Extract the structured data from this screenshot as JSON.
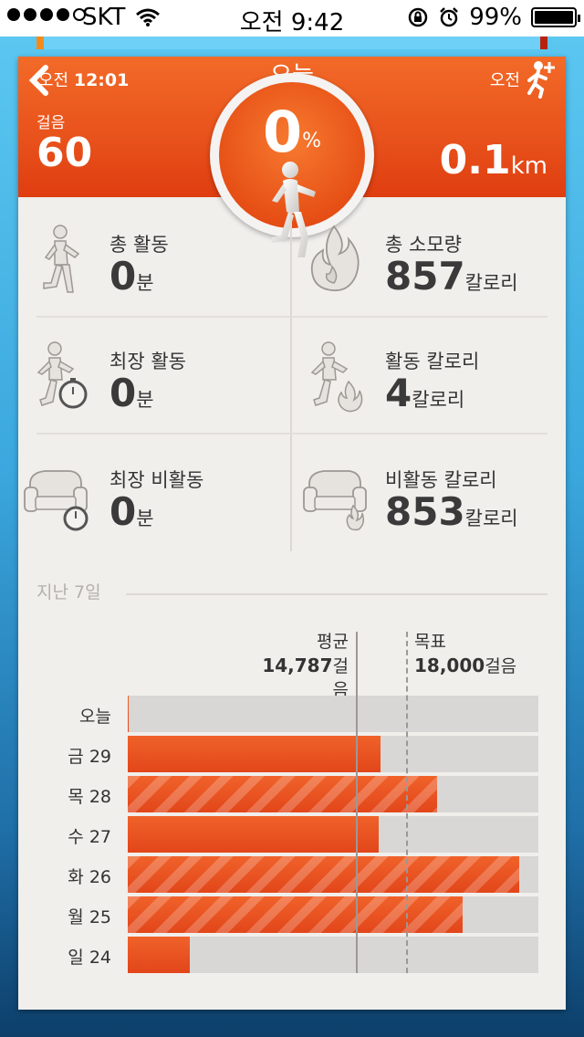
{
  "status_bar": {
    "carrier": "SKT",
    "time": "오전 9:42",
    "battery": "99%"
  },
  "header": {
    "back_time_prefix": "오전",
    "back_time": "12:01",
    "title": "오늘",
    "right_time_prefix": "오전",
    "steps_label": "걸음",
    "steps_value": "60",
    "percent_value": "0",
    "percent_unit": "%",
    "distance_value": "0.1",
    "distance_unit": "km",
    "colors": {
      "accent": "#e8511b",
      "accent_dark": "#d63f0e"
    }
  },
  "stats": [
    {
      "label": "총 활동",
      "value": "0",
      "unit": "분",
      "icon": "walking-person-icon"
    },
    {
      "label": "총 소모량",
      "value": "857",
      "unit": "칼로리",
      "icon": "flame-icon"
    },
    {
      "label": "최장 활동",
      "value": "0",
      "unit": "분",
      "icon": "person-stopwatch-icon"
    },
    {
      "label": "활동 칼로리",
      "value": "4",
      "unit": "칼로리",
      "icon": "person-flame-icon"
    },
    {
      "label": "최장 비활동",
      "value": "0",
      "unit": "분",
      "icon": "armchair-stopwatch-icon"
    },
    {
      "label": "비활동 칼로리",
      "value": "853",
      "unit": "칼로리",
      "icon": "armchair-flame-icon"
    }
  ],
  "week": {
    "title": "지난 7일",
    "avg_label": "평균",
    "avg_value": "14,787",
    "avg_unit": "걸음",
    "goal_label": "목표",
    "goal_value": "18,000",
    "goal_unit": "걸음",
    "days": [
      {
        "label": "오늘",
        "steps_fraction": 0.003,
        "striped": false
      },
      {
        "label": "금 29",
        "steps_fraction": 0.615,
        "striped": false
      },
      {
        "label": "목 28",
        "steps_fraction": 0.753,
        "striped": true
      },
      {
        "label": "수 27",
        "steps_fraction": 0.611,
        "striped": false
      },
      {
        "label": "화 26",
        "steps_fraction": 0.953,
        "striped": true
      },
      {
        "label": "월 25",
        "steps_fraction": 0.815,
        "striped": true
      },
      {
        "label": "일 24",
        "steps_fraction": 0.151,
        "striped": false
      }
    ]
  }
}
